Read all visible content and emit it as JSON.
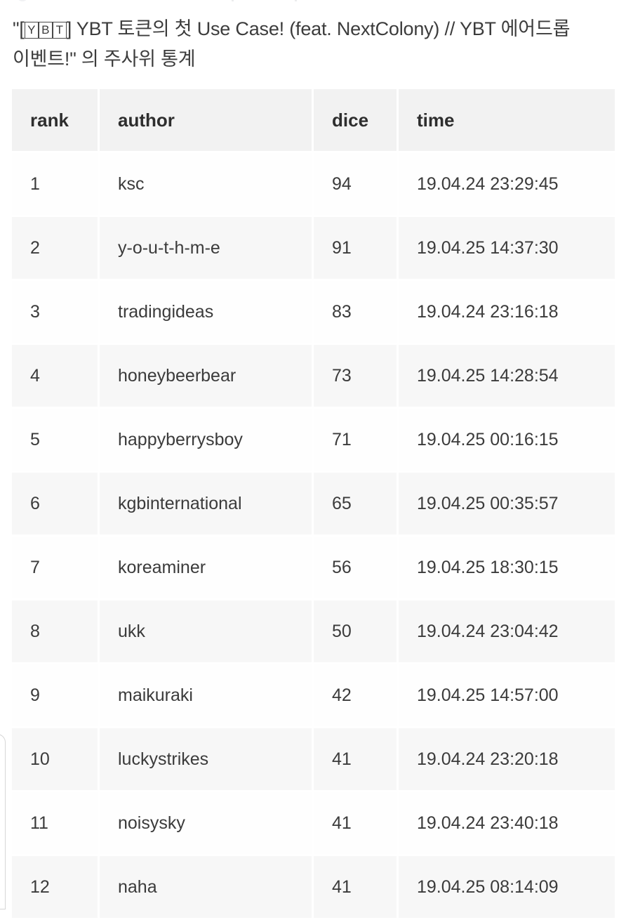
{
  "page": {
    "title_line1_prefix": "\"[",
    "title_boxed_chars": [
      "Y",
      "B",
      "T"
    ],
    "title_line1_suffix": "] YBT 토큰의 첫 Use Case! (feat. NextColony) // YBT 에어드롭",
    "title_line2": "이벤트!\" 의 주사위 통계",
    "title_full": "\"[YBT] YBT 토큰의 첫 Use Case! (feat. NextColony) // YBT 에어드롭 이벤트!\" 의 주사위 통계"
  },
  "table": {
    "columns": [
      {
        "key": "rank",
        "label": "rank"
      },
      {
        "key": "author",
        "label": "author"
      },
      {
        "key": "dice",
        "label": "dice"
      },
      {
        "key": "time",
        "label": "time"
      }
    ],
    "rows": [
      {
        "rank": "1",
        "author": "ksc",
        "dice": "94",
        "time": "19.04.24 23:29:45"
      },
      {
        "rank": "2",
        "author": "y-o-u-t-h-m-e",
        "dice": "91",
        "time": "19.04.25 14:37:30"
      },
      {
        "rank": "3",
        "author": "tradingideas",
        "dice": "83",
        "time": "19.04.24 23:16:18"
      },
      {
        "rank": "4",
        "author": "honeybeerbear",
        "dice": "73",
        "time": "19.04.25 14:28:54"
      },
      {
        "rank": "5",
        "author": "happyberrysboy",
        "dice": "71",
        "time": "19.04.25 00:16:15"
      },
      {
        "rank": "6",
        "author": "kgbinternational",
        "dice": "65",
        "time": "19.04.25 00:35:57"
      },
      {
        "rank": "7",
        "author": "koreaminer",
        "dice": "56",
        "time": "19.04.25 18:30:15"
      },
      {
        "rank": "8",
        "author": "ukk",
        "dice": "50",
        "time": "19.04.24 23:04:42"
      },
      {
        "rank": "9",
        "author": "maikuraki",
        "dice": "42",
        "time": "19.04.25 14:57:00"
      },
      {
        "rank": "10",
        "author": "luckystrikes",
        "dice": "41",
        "time": "19.04.24 23:20:18"
      },
      {
        "rank": "11",
        "author": "noisysky",
        "dice": "41",
        "time": "19.04.24 23:40:18"
      },
      {
        "rank": "12",
        "author": "naha",
        "dice": "41",
        "time": "19.04.25 08:14:09"
      }
    ]
  },
  "colors": {
    "page_background": "#ffffff",
    "header_cell_background": "#f2f2f2",
    "row_odd_background": "#f7f7f7",
    "row_even_background": "#fefefe",
    "text": "#3b3b3b",
    "header_text": "#2e2e2e",
    "panel_edge_border": "#d6d6d6"
  }
}
